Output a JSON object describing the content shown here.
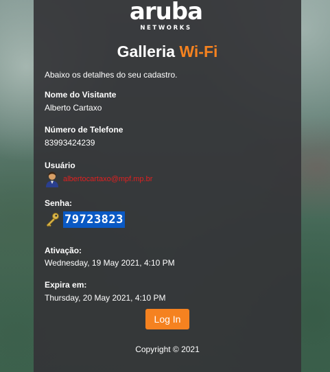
{
  "brand": {
    "logo_text": "aruba",
    "logo_sub": "NETWORKS"
  },
  "header": {
    "title_main": "Galleria",
    "title_accent": "Wi-Fi"
  },
  "intro": "Abaixo os detalhes do seu cadastro.",
  "fields": {
    "visitor": {
      "label": "Nome do Visitante",
      "value": "Alberto Cartaxo"
    },
    "phone": {
      "label": "Número de Telefone",
      "value": "83993424239"
    },
    "user": {
      "label": "Usuário",
      "value": "albertocartaxo@mpf.mp.br"
    },
    "password": {
      "label": "Senha:",
      "value": "79723823"
    },
    "activation": {
      "label": "Ativação:",
      "value": "Wednesday, 19 May 2021, 4:10 PM"
    },
    "expires": {
      "label": "Expira em:",
      "value": "Thursday, 20 May 2021, 4:10 PM"
    }
  },
  "actions": {
    "login_label": "Log In"
  },
  "footer": {
    "copyright": "Copyright © 2021"
  },
  "colors": {
    "accent": "#f58220",
    "email": "#e02020",
    "selection": "#0a59c4",
    "panel": "#343437"
  },
  "icons": {
    "user": "user-avatar-icon",
    "password": "key-icon"
  }
}
